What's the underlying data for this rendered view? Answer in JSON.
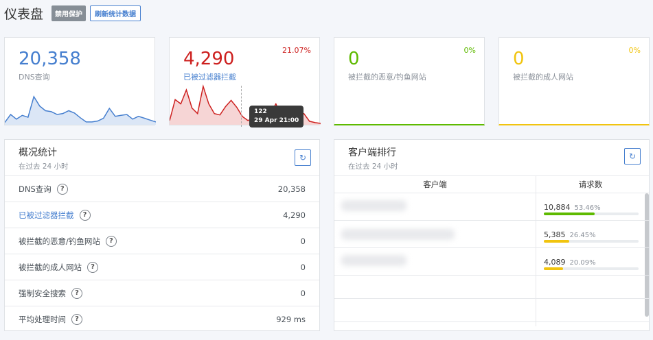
{
  "header": {
    "title": "仪表盘",
    "disable_label": "禁用保护",
    "refresh_label": "刷新统计数据"
  },
  "cards": [
    {
      "value": "20,358",
      "label": "DNS查询",
      "percent": "",
      "color": "#467fcf",
      "fill": "#dbe6f6"
    },
    {
      "value": "4,290",
      "label": "已被过滤器拦截",
      "percent": "21.07%",
      "color": "#cd201f",
      "fill": "#f6d5d5"
    },
    {
      "value": "0",
      "label": "被拦截的恶意/钓鱼网站",
      "percent": "0%",
      "color": "#5eba00",
      "fill": "#e4f3d6"
    },
    {
      "value": "0",
      "label": "被拦截的成人网站",
      "percent": "0%",
      "color": "#f1c40f",
      "fill": "#fdf3cf"
    }
  ],
  "spark": {
    "dns": [
      5,
      22,
      12,
      20,
      16,
      60,
      40,
      30,
      28,
      22,
      24,
      30,
      25,
      15,
      6,
      6,
      8,
      14,
      35,
      18,
      20,
      22,
      12,
      18,
      14,
      10,
      6
    ],
    "blocked": [
      6,
      36,
      30,
      50,
      24,
      16,
      55,
      30,
      16,
      14,
      26,
      35,
      25,
      12,
      6,
      10,
      10,
      12,
      16,
      30,
      12,
      16,
      22,
      14,
      16,
      5,
      3,
      2
    ]
  },
  "tooltip": {
    "value": "122",
    "time": "29 Apr 21:00"
  },
  "overview": {
    "title": "概况统计",
    "subtitle": "在过去 24 小时",
    "rows": [
      {
        "label": "DNS查询",
        "value": "20,358",
        "link": false
      },
      {
        "label": "已被过滤器拦截",
        "value": "4,290",
        "link": true
      },
      {
        "label": "被拦截的恶意/钓鱼网站",
        "value": "0",
        "link": false
      },
      {
        "label": "被拦截的成人网站",
        "value": "0",
        "link": false
      },
      {
        "label": "强制安全搜索",
        "value": "0",
        "link": false
      },
      {
        "label": "平均处理时间",
        "value": "929 ms",
        "link": false
      }
    ]
  },
  "clients": {
    "title": "客户端排行",
    "subtitle": "在过去 24 小时",
    "col_client": "客户端",
    "col_requests": "请求数",
    "rows": [
      {
        "count": "10,884",
        "percent": "53.46%",
        "ratio": 0.5346,
        "color": "#5eba00"
      },
      {
        "count": "5,385",
        "percent": "26.45%",
        "ratio": 0.2645,
        "color": "#f1c40f"
      },
      {
        "count": "4,089",
        "percent": "20.09%",
        "ratio": 0.2009,
        "color": "#f1c40f"
      }
    ]
  },
  "icons": {
    "refresh": "refresh-icon",
    "help": "question-icon"
  }
}
